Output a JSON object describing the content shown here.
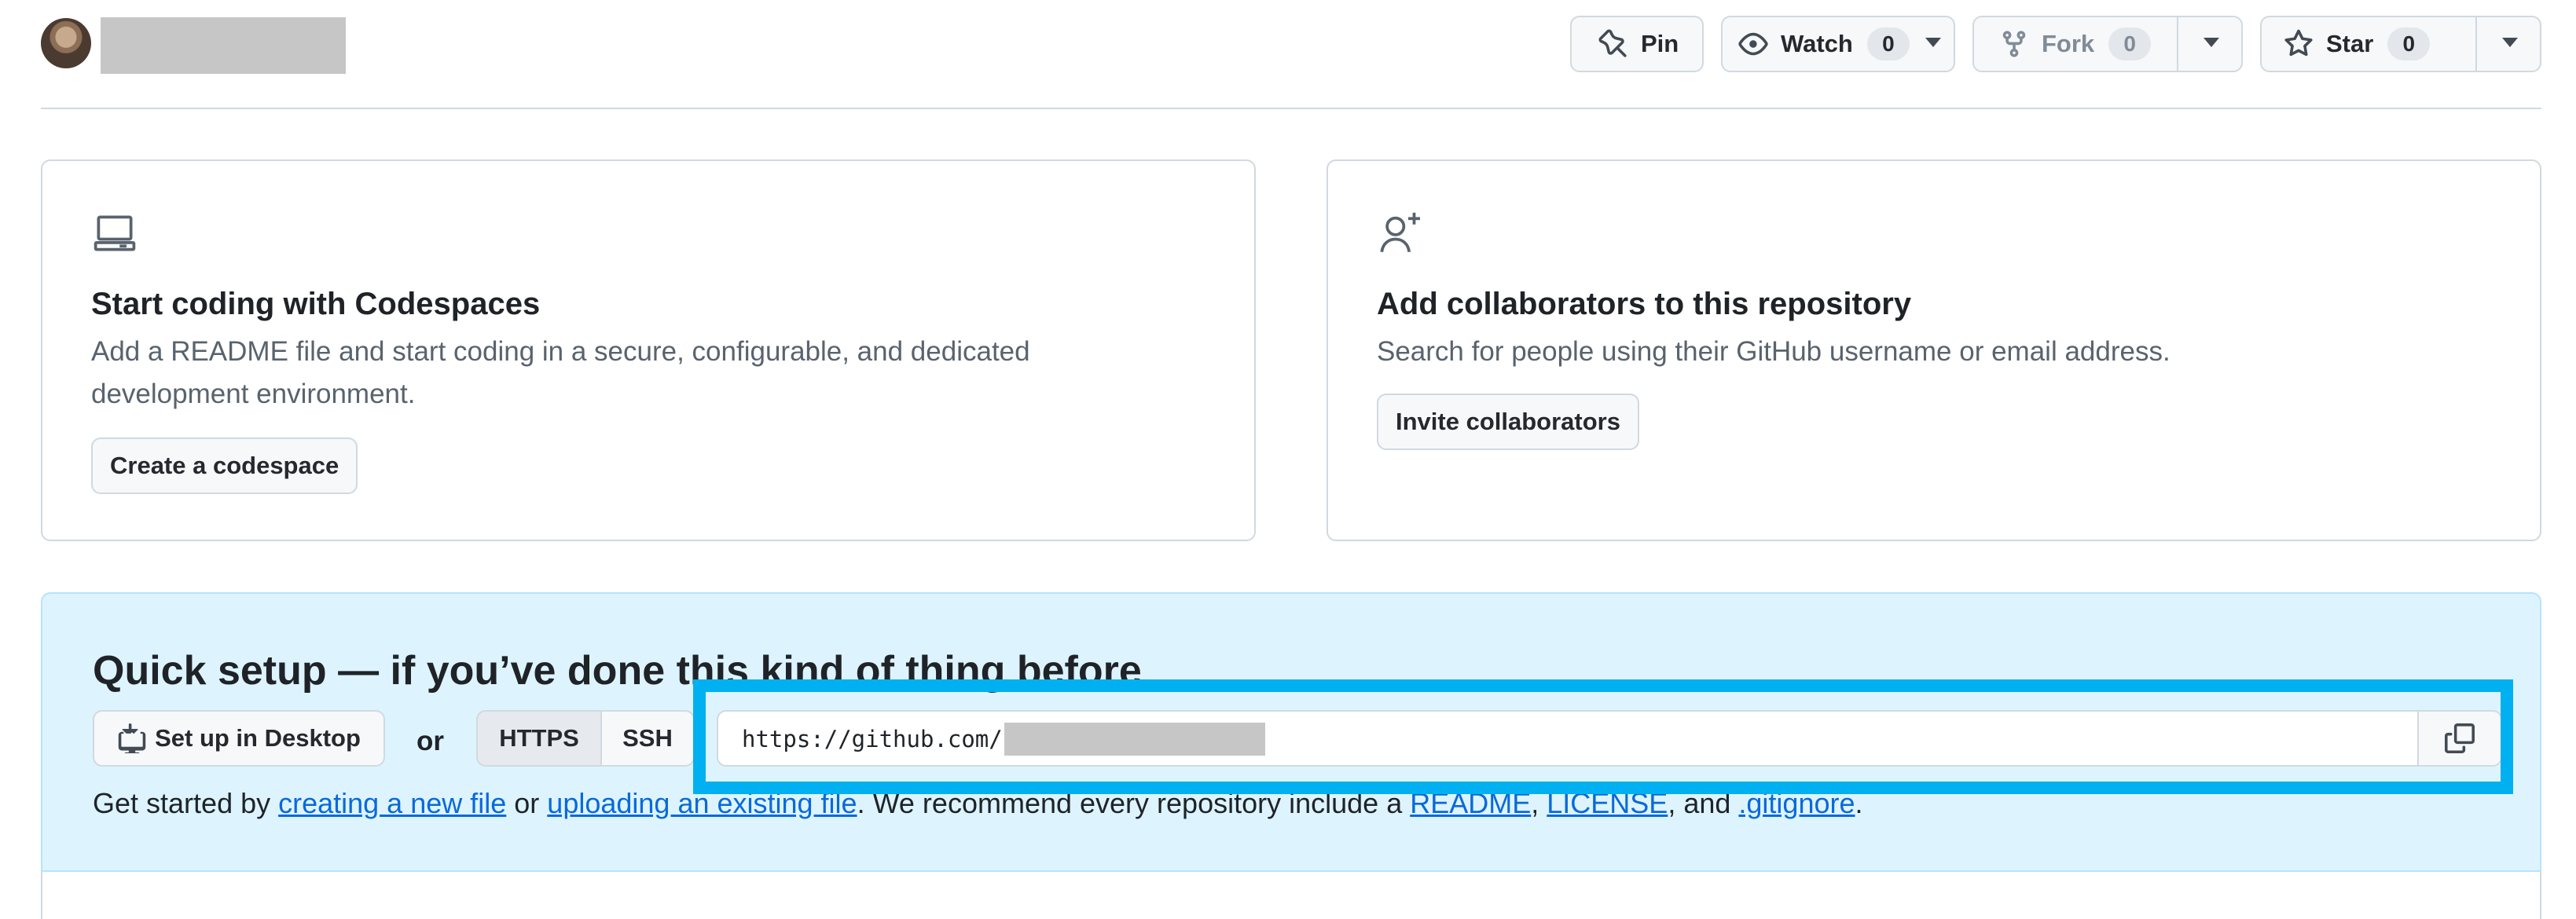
{
  "header": {
    "avatar_alt": "avatar",
    "pin": {
      "label": "Pin"
    },
    "watch": {
      "label": "Watch",
      "count": "0"
    },
    "fork": {
      "label": "Fork",
      "count": "0"
    },
    "star": {
      "label": "Star",
      "count": "0"
    }
  },
  "cards": {
    "codespaces": {
      "icon": "codespaces-icon",
      "title": "Start coding with Codespaces",
      "description": "Add a README file and start coding in a secure, configurable, and dedicated development environment.",
      "button": "Create a codespace"
    },
    "collaborators": {
      "icon": "person-add-icon",
      "title": "Add collaborators to this repository",
      "description": "Search for people using their GitHub username or email address.",
      "button": "Invite collaborators"
    }
  },
  "quick_setup": {
    "title": "Quick setup — if you’ve done this kind of thing before",
    "desktop_button": "Set up in Desktop",
    "or": "or",
    "protocols": [
      "HTTPS",
      "SSH"
    ],
    "selected_protocol": "HTTPS",
    "url_prefix": "https://github.com/",
    "line": {
      "prefix": "Get started by ",
      "link_new_file": "creating a new file",
      "mid1": " or ",
      "link_upload": "uploading an existing file",
      "mid2": ". We recommend every repository include a ",
      "link_readme": "README",
      "comma1": ", ",
      "link_license": "LICENSE",
      "mid3": ", and ",
      "link_gitignore": ".gitignore",
      "suffix": "."
    }
  },
  "colors": {
    "accent_link": "#0969da",
    "highlight": "#00b0f0",
    "quick_bg": "#ddf4ff"
  }
}
